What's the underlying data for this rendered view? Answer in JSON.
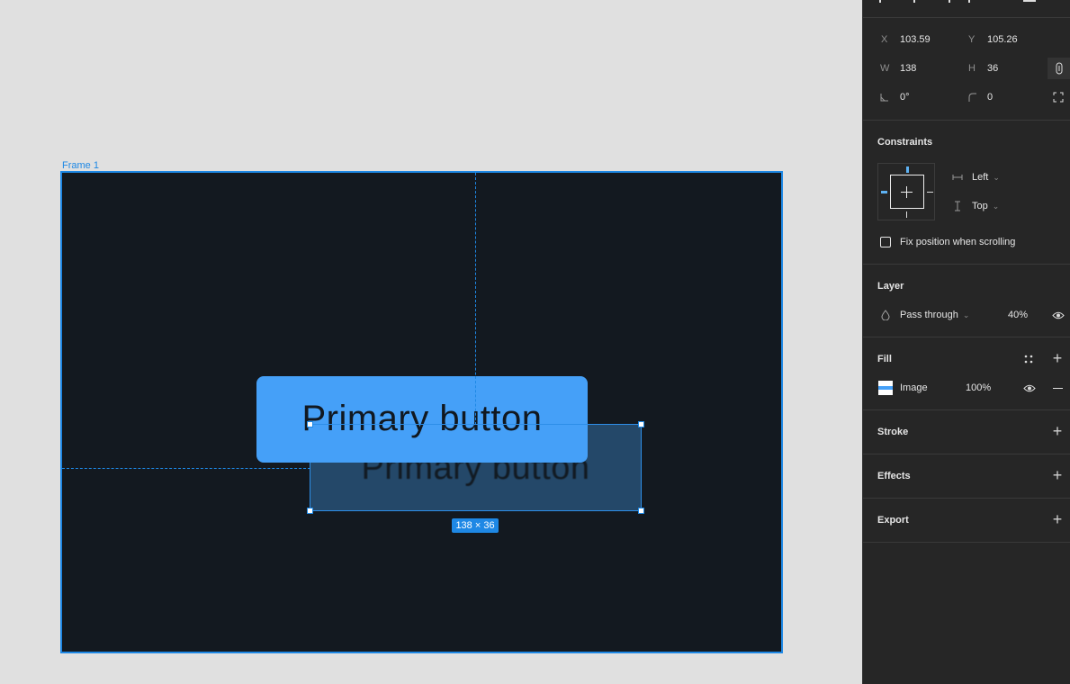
{
  "canvas": {
    "frame_label": "Frame 1",
    "primary_button_label": "Primary button",
    "ghost_button_label": "Primary button",
    "selection_size_badge": "138 × 36",
    "colors": {
      "accent": "#1e88e5",
      "frame_bg": "#131920",
      "button_bg": "#45a0f8",
      "canvas_bg": "#e0e0e0"
    }
  },
  "panel": {
    "position": {
      "x_label": "X",
      "x_value": "103.59",
      "y_label": "Y",
      "y_value": "105.26",
      "w_label": "W",
      "w_value": "138",
      "h_label": "H",
      "h_value": "36",
      "rotation_value": "0°",
      "radius_value": "0"
    },
    "constraints": {
      "title": "Constraints",
      "horizontal": "Left",
      "vertical": "Top",
      "fix_position_label": "Fix position when scrolling",
      "fix_position_checked": false
    },
    "layer": {
      "title": "Layer",
      "blend_mode": "Pass through",
      "opacity": "40%"
    },
    "fill": {
      "title": "Fill",
      "type": "Image",
      "opacity": "100%"
    },
    "stroke": {
      "title": "Stroke"
    },
    "effects": {
      "title": "Effects"
    },
    "export": {
      "title": "Export"
    }
  }
}
